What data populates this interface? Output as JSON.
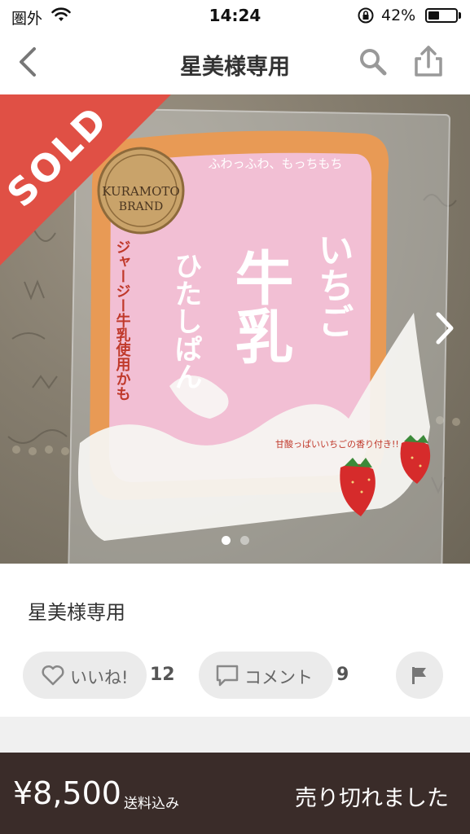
{
  "status_bar": {
    "carrier": "圏外",
    "time": "14:24",
    "battery_percent": "42%",
    "battery_level": 0.42,
    "icons": [
      "wifi-icon",
      "rotation-lock-icon",
      "battery-icon"
    ]
  },
  "nav": {
    "title": "星美様専用",
    "icons": [
      "back-chevron-icon",
      "search-icon",
      "share-icon"
    ]
  },
  "product_image": {
    "sold_label": "SOLD",
    "badge_line1": "",
    "badge_line2": "KURAMOTO",
    "badge_line3": "BRAND",
    "pkg_text_top": "ふわっふわ、もっちもち",
    "pkg_text_main1": "いちご",
    "pkg_text_main2": "牛乳",
    "pkg_text_main3": "ひたしぱん",
    "pkg_text_side": "ジャージー牛乳使用かも",
    "pkg_text_scent": "甘酸っぱいいちごの香り付き!!",
    "carousel_total": 2,
    "carousel_active": 0
  },
  "item": {
    "title": "星美様専用",
    "like_label": "いいね!",
    "like_count": "12",
    "comment_label": "コメント",
    "comment_count": "9"
  },
  "bottom_bar": {
    "price": "¥8,500",
    "shipping": "送料込み",
    "status": "売り切れました"
  },
  "colors": {
    "sold_banner": "#e05045",
    "bottom_bar": "#3a2c29",
    "pill_bg": "#ebebeb"
  }
}
